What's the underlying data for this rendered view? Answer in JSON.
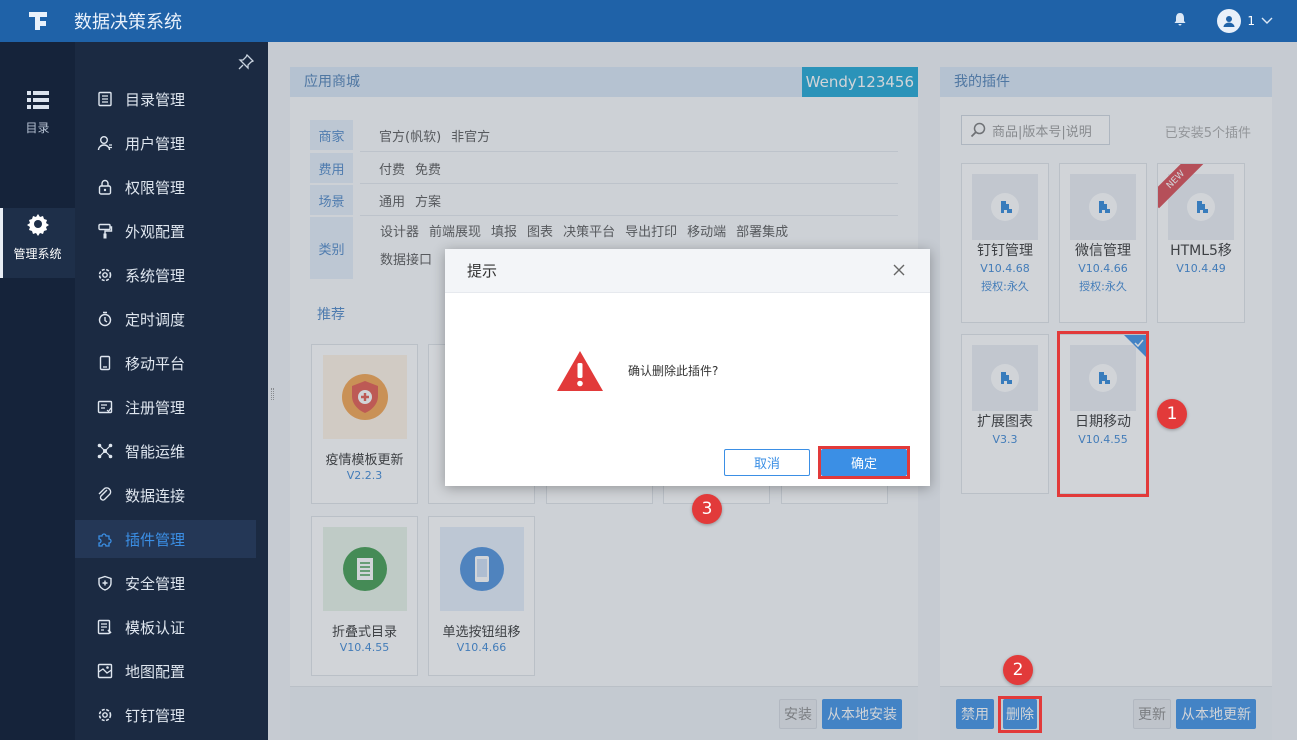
{
  "header": {
    "app_title": "数据决策系统",
    "user_name": "1"
  },
  "rail": [
    {
      "label": "目录",
      "icon": "list-icon"
    },
    {
      "label": "管理系统",
      "icon": "gear-icon"
    }
  ],
  "sidebar": {
    "items": [
      {
        "label": "目录管理",
        "icon": "catalog-icon"
      },
      {
        "label": "用户管理",
        "icon": "user-icon"
      },
      {
        "label": "权限管理",
        "icon": "lock-icon"
      },
      {
        "label": "外观配置",
        "icon": "brush-icon"
      },
      {
        "label": "系统管理",
        "icon": "gear-icon"
      },
      {
        "label": "定时调度",
        "icon": "timer-icon"
      },
      {
        "label": "移动平台",
        "icon": "mobile-icon"
      },
      {
        "label": "注册管理",
        "icon": "register-icon"
      },
      {
        "label": "智能运维",
        "icon": "network-icon"
      },
      {
        "label": "数据连接",
        "icon": "link-icon"
      },
      {
        "label": "插件管理",
        "icon": "puzzle-icon"
      },
      {
        "label": "安全管理",
        "icon": "shield-icon"
      },
      {
        "label": "模板认证",
        "icon": "template-icon"
      },
      {
        "label": "地图配置",
        "icon": "map-icon"
      },
      {
        "label": "钉钉管理",
        "icon": "gear-icon"
      }
    ],
    "active_index": 10
  },
  "store": {
    "title": "应用商城",
    "user_tag": "Wendy123456",
    "filters": [
      {
        "key": "商家",
        "values": [
          "官方(帆软)",
          "非官方"
        ]
      },
      {
        "key": "费用",
        "values": [
          "付费",
          "免费"
        ]
      },
      {
        "key": "场景",
        "values": [
          "通用",
          "方案"
        ]
      },
      {
        "key": "类别",
        "values": [
          "设计器",
          "前端展现",
          "填报",
          "图表",
          "决策平台",
          "导出打印",
          "移动端",
          "部署集成",
          "数据接口"
        ]
      }
    ],
    "recommend_title": "推荐",
    "cards": [
      {
        "name": "疫情模板更新",
        "version": "V2.2.3"
      },
      {
        "name": "折叠式目录",
        "version": "V10.4.55"
      },
      {
        "name": "单选按钮组移",
        "version": "V10.4.66"
      }
    ],
    "install_label": "安装",
    "install_local_label": "从本地安装"
  },
  "mine": {
    "title": "我的插件",
    "search_placeholder": "商品|版本号|说明",
    "installed_text": "已安装5个插件",
    "plugins": [
      {
        "name": "钉钉管理",
        "version": "V10.4.68",
        "license": "授权:永久"
      },
      {
        "name": "微信管理",
        "version": "V10.4.66",
        "license": "授权:永久"
      },
      {
        "name": "HTML5移",
        "version": "V10.4.49",
        "badge": "NEW"
      },
      {
        "name": "扩展图表",
        "version": "V3.3"
      },
      {
        "name": "日期移动",
        "version": "V10.4.55"
      }
    ],
    "disable_label": "禁用",
    "delete_label": "删除",
    "update_label": "更新",
    "update_local_label": "从本地更新"
  },
  "dialog": {
    "title": "提示",
    "message": "确认删除此插件?",
    "cancel_label": "取消",
    "confirm_label": "确定"
  },
  "annotations": [
    "1",
    "2",
    "3"
  ],
  "colors": {
    "topbar": "#1f62a8",
    "accent": "#3b8fe5",
    "highlight": "#e23a3a"
  }
}
